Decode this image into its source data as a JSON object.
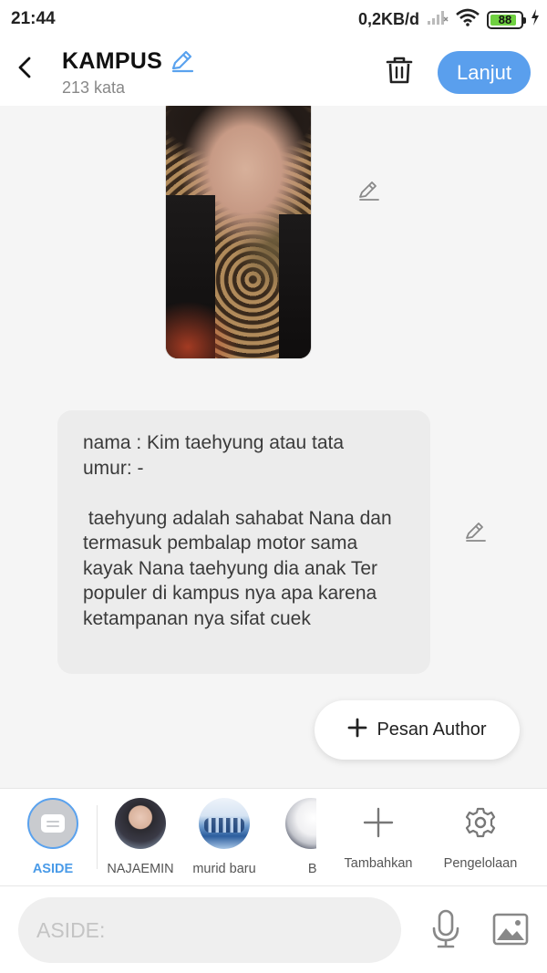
{
  "status_bar": {
    "time": "21:44",
    "network_speed": "0,2KB/d",
    "battery_level": "88",
    "battery_fraction": 0.88
  },
  "header": {
    "title": "KAMPUS",
    "word_count": "213 kata",
    "next_label": "Lanjut"
  },
  "message": {
    "text": "nama : Kim taehyung atau tata\numur: -\n\n taehyung adalah sahabat Nana dan termasuk pembalap motor sama kayak Nana taehyung dia anak Ter populer di kampus nya apa karena ketampanan nya sifat cuek"
  },
  "author_button": {
    "label": "Pesan Author"
  },
  "characters": [
    {
      "label": "ASIDE",
      "active": true
    },
    {
      "label": "NAJAEMIN",
      "active": false
    },
    {
      "label": "murid baru",
      "active": false
    },
    {
      "label": "Bill",
      "active": false
    }
  ],
  "tools": {
    "add_label": "Tambahkan",
    "manage_label": "Pengelolaan"
  },
  "input": {
    "placeholder": "ASIDE:",
    "value": ""
  },
  "colors": {
    "accent": "#5a9fed",
    "active_label": "#4a9be8",
    "battery": "#6fd040"
  },
  "icons": [
    "back-arrow-icon",
    "pencil-icon",
    "trash-icon",
    "plus-icon",
    "gear-icon",
    "microphone-icon",
    "image-icon",
    "wifi-icon",
    "signal-icon",
    "charging-icon"
  ]
}
